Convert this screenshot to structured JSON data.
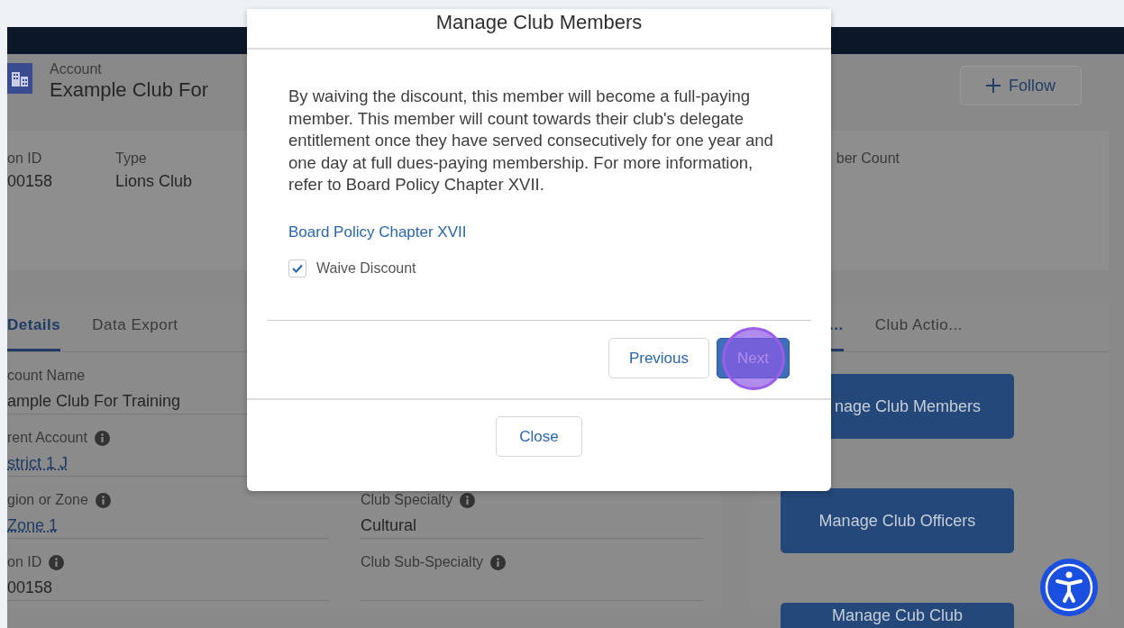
{
  "record": {
    "object_type": "Account",
    "title": "Example Club For",
    "follow_button": "Follow",
    "highlights": [
      {
        "label": "on ID",
        "value": "00158"
      },
      {
        "label": "Type",
        "value": "Lions Club"
      },
      {
        "label": "ber Count"
      }
    ],
    "tabs": [
      {
        "label": "Details",
        "selected": true
      },
      {
        "label": "Data Export",
        "selected": false
      }
    ],
    "fields_left": [
      {
        "label": "count Name",
        "info": false,
        "kind": "text",
        "value": "ample Club For Training"
      },
      {
        "label": "rent Account",
        "info": true,
        "kind": "link",
        "value": "strict 1 J"
      },
      {
        "label": "gion or Zone",
        "info": true,
        "kind": "link",
        "value": "Zone 1"
      },
      {
        "label": "on ID",
        "info": true,
        "kind": "text",
        "value": "00158"
      }
    ],
    "fields_right": [
      {
        "label": "Club Specialty",
        "info": true,
        "kind": "text",
        "value": "Cultural"
      },
      {
        "label": "Club Sub-Specialty",
        "info": true
      }
    ],
    "side_tabs": [
      {
        "label": "...",
        "selected": true
      },
      {
        "label": "Club Actio...",
        "selected": false
      }
    ],
    "actions": [
      {
        "label": "nage Club Members"
      },
      {
        "label": "Manage Club Officers"
      },
      {
        "label": "Manage Cub Club"
      }
    ]
  },
  "modal": {
    "title": "Manage Club Members",
    "message": "By waiving the discount, this member will become a full-paying member. This member will count towards their club's delegate entitlement once they have served consecutively for one year and one day at full dues-paying membership. For more information, refer to Board Policy Chapter XVII.",
    "link": "Board Policy Chapter XVII",
    "checkbox": {
      "label": "Waive Discount",
      "checked": true
    },
    "buttons": [
      {
        "label": "Previous",
        "kind": "neutral",
        "highlighted": false
      },
      {
        "label": "Next",
        "kind": "brand",
        "highlighted": true
      }
    ],
    "close_button": "Close"
  }
}
